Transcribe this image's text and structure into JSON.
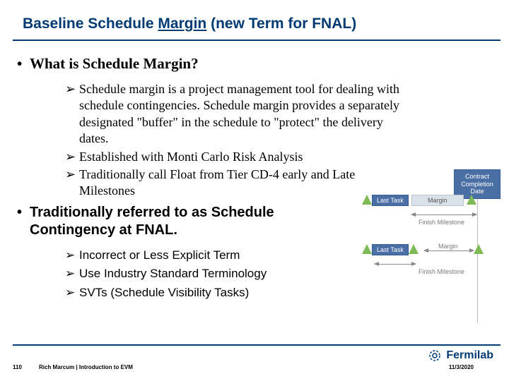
{
  "title": {
    "pre": "Baseline Schedule ",
    "underlined": "Margin",
    "post": " (new Term for FNAL)"
  },
  "section1": {
    "heading": "What is Schedule Margin?",
    "bullets": [
      "Schedule margin is a project management tool for dealing with schedule contingencies. Schedule margin provides a separately designated \"buffer\" in the schedule to \"protect\" the delivery dates.",
      "Established with Monti Carlo Risk Analysis",
      "Traditionally call Float from Tier CD-4 early and Late Milestones"
    ]
  },
  "section2": {
    "heading": "Traditionally referred to as Schedule Contingency at FNAL.",
    "bullets": [
      "Incorrect or Less Explicit Term",
      "Use Industry Standard Terminology",
      "SVTs (Schedule Visibility Tasks)"
    ]
  },
  "diagram": {
    "ccd": "Contract Completion Date",
    "last_task": "Last Task",
    "margin": "Margin",
    "finish_milestone": "Finish Milestone"
  },
  "footer": {
    "slide_number": "110",
    "author_line": "Rich Marcum | Introduction to EVM",
    "date": "11/3/2020",
    "brand": "Fermilab"
  }
}
